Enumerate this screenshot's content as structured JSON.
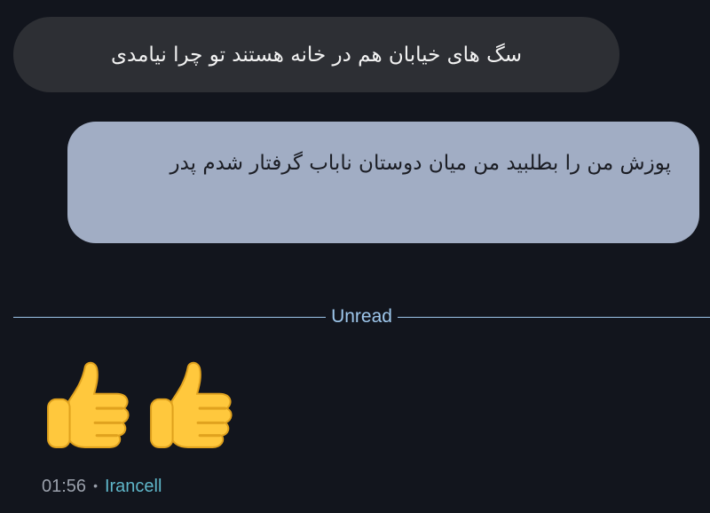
{
  "messages": [
    {
      "direction": "incoming",
      "text": "سگ های خیابان هم در خانه هستند تو چرا نیامدی"
    },
    {
      "direction": "outgoing",
      "text": "پوزش من را بطلبید من میان دوستان ناباب گرفتار شدم پدر"
    }
  ],
  "divider": {
    "label": "Unread"
  },
  "reaction_message": {
    "emojis": [
      "thumbs-up-icon",
      "thumbs-up-icon"
    ],
    "time": "01:56",
    "separator": "•",
    "sender": "Irancell"
  },
  "colors": {
    "background": "#12151d",
    "incoming_bubble": "#2d2f34",
    "outgoing_bubble": "#a1adc4",
    "divider": "#9ec7ec",
    "sender": "#5fb6c9",
    "emoji_yellow": "#ffc83d"
  }
}
